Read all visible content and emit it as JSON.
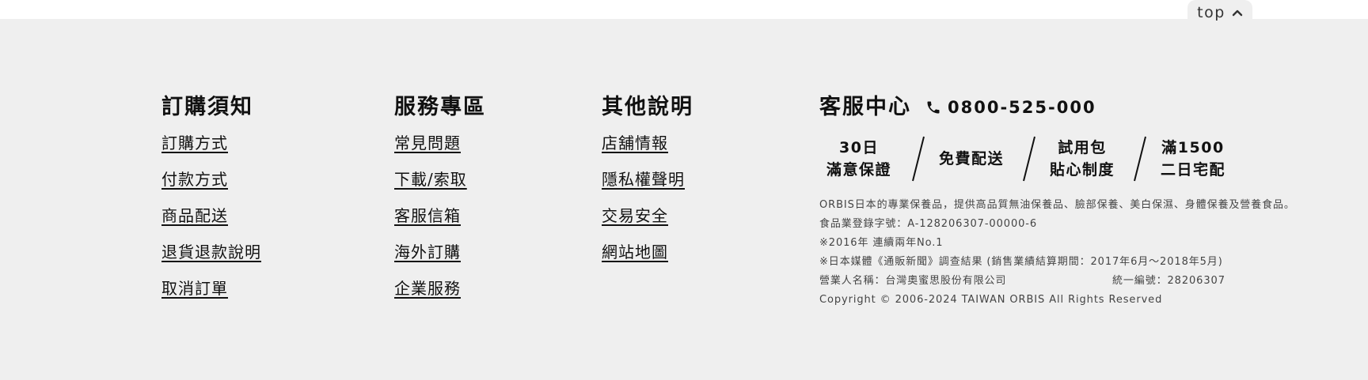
{
  "top_button": {
    "label": "top"
  },
  "columns": [
    {
      "title": "訂購須知",
      "links": [
        "訂購方式",
        "付款方式",
        "商品配送",
        "退貨退款說明",
        "取消訂單"
      ]
    },
    {
      "title": "服務專區",
      "links": [
        "常見問題",
        "下載/索取",
        "客服信箱",
        "海外訂購",
        "企業服務"
      ]
    },
    {
      "title": "其他說明",
      "links": [
        "店舖情報",
        "隱私權聲明",
        "交易安全",
        "網站地圖"
      ]
    }
  ],
  "customer_service": {
    "title": "客服中心",
    "phone_icon": "phone-icon",
    "phone": "0800-525-000",
    "features": [
      {
        "line1": "30日",
        "line2": "滿意保證"
      },
      {
        "line1": "免費配送",
        "line2": ""
      },
      {
        "line1": "試用包",
        "line2": "貼心制度"
      },
      {
        "line1": "滿1500",
        "line2": "二日宅配"
      }
    ],
    "info": {
      "description": "ORBIS日本的專業保養品，提供高品質無油保養品、臉部保養、美白保濕、身體保養及營養食品。",
      "food_registration": "食品業登錄字號：A-128206307-00000-6",
      "award_2016": "※2016年 連續兩年No.1",
      "survey": "※日本媒體《通販新聞》調查結果 (銷售業績結算期間：2017年6月～2018年5月)",
      "company_name": "營業人名稱：台灣奧蜜思股份有限公司",
      "tax_id": "統一編號：28206307",
      "copyright": "Copyright © 2006-2024 TAIWAN ORBIS All Rights Reserved"
    }
  },
  "colors": {
    "footer_bg": "#efefef",
    "text": "#111111",
    "muted_text": "#444444"
  }
}
